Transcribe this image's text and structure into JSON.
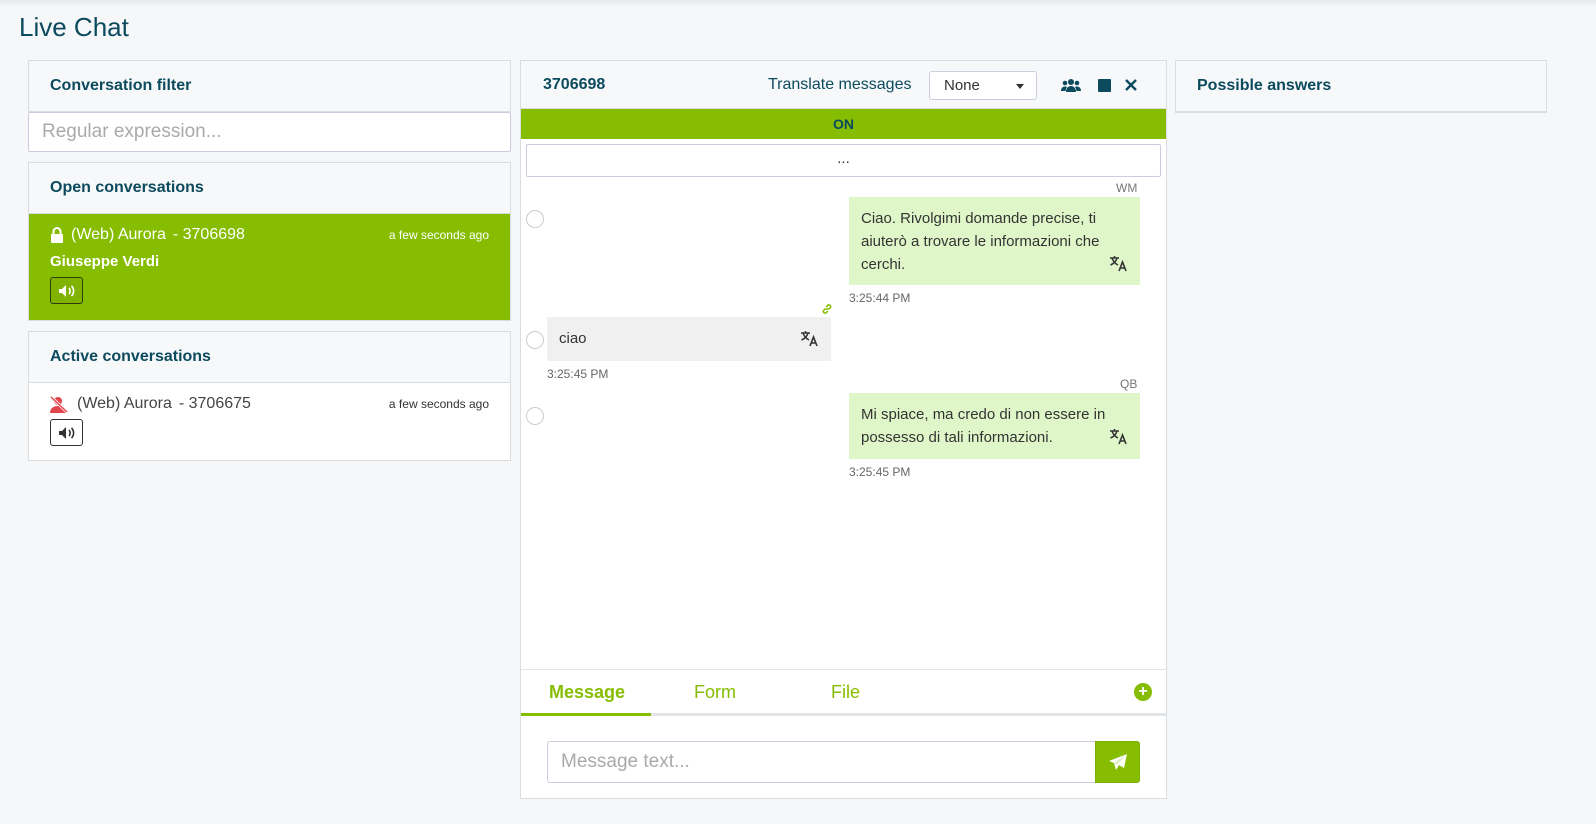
{
  "page": {
    "title": "Live Chat"
  },
  "filter": {
    "title": "Conversation filter",
    "placeholder": "Regular expression..."
  },
  "open_conversations": {
    "title": "Open conversations",
    "items": [
      {
        "channel": "(Web) Aurora",
        "id": "- 3706698",
        "time": "a few seconds ago",
        "user": "Giuseppe Verdi"
      }
    ]
  },
  "active_conversations": {
    "title": "Active conversations",
    "items": [
      {
        "channel": "(Web) Aurora",
        "id": "- 3706675",
        "time": "a few seconds ago"
      }
    ]
  },
  "chat": {
    "id": "3706698",
    "translate_label": "Translate messages",
    "translate_value": "None",
    "status": "ON",
    "more_label": "...",
    "messages": [
      {
        "author": "WM",
        "side": "bot",
        "text": "Ciao. Rivolgimi domande precise, ti aiuterò a trovare le informazioni che cerchi.",
        "time": "3:25:44 PM"
      },
      {
        "author": "",
        "side": "user",
        "text": "ciao",
        "time": "3:25:45 PM"
      },
      {
        "author": "QB",
        "side": "bot",
        "text": "Mi spiace, ma credo di non essere in possesso di tali informazioni.",
        "time": "3:25:45 PM"
      }
    ],
    "tabs": [
      {
        "label": "Message"
      },
      {
        "label": "Form"
      },
      {
        "label": "File"
      }
    ],
    "composer_placeholder": "Message text..."
  },
  "possible_answers": {
    "title": "Possible answers"
  },
  "colors": {
    "accent": "#86bd00",
    "title": "#0c4a5e",
    "bot_bubble": "#dff7c8",
    "user_bubble": "#f0f0f0",
    "alert": "#e2454b"
  },
  "icons": [
    "lock-icon",
    "sound-icon",
    "user-slash-icon",
    "users-icon",
    "stop-icon",
    "close-icon",
    "translate-icon",
    "link-icon",
    "plus-circle-icon",
    "send-icon"
  ]
}
